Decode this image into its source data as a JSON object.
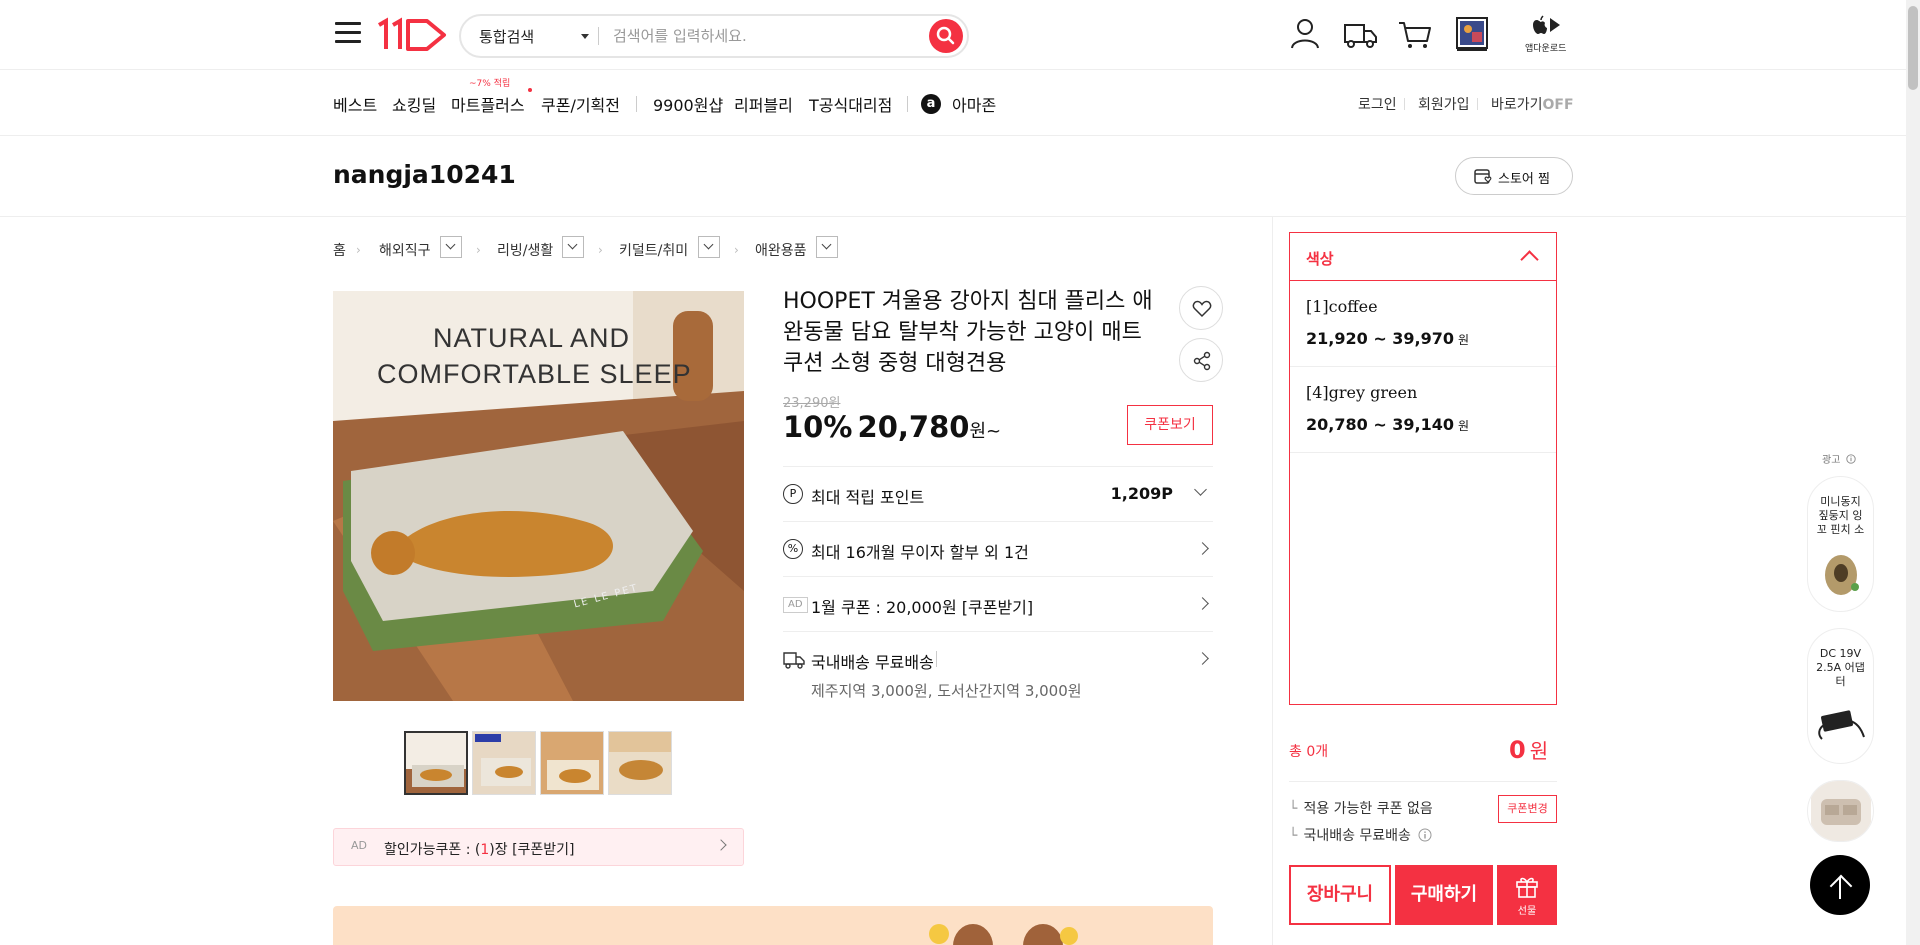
{
  "header": {
    "search_category": "통합검색",
    "search_placeholder": "검색어를 입력하세요.",
    "app_download": "앱다운로드"
  },
  "gnb": {
    "items": [
      "베스트",
      "쇼킹딜",
      "마트플러스",
      "쿠폰/기획전",
      "9900원샵",
      "리퍼블리",
      "T공식대리점",
      "아마존"
    ],
    "mart_badge": "~7% 적립",
    "login": "로그인",
    "signup": "회원가입",
    "shortcut": "바로가기",
    "shortcut_state": "OFF"
  },
  "store": {
    "name": "nangja10241",
    "follow": "스토어 찜"
  },
  "breadcrumb": [
    "홈",
    "해외직구",
    "리빙/생활",
    "키덜트/취미",
    "애완용품"
  ],
  "product": {
    "image_text_line1": "NATURAL AND",
    "image_text_line2": "COMFORTABLE SLEEP",
    "image_brand": "LE LE PET",
    "title": "HOOPET 겨울용 강아지 침대 플리스 애완동물 담요 탈부착 가능한 고양이 매트 쿠션 소형 중형 대형견용",
    "original_price": "23,290원",
    "discount": "10%",
    "price": "20,780",
    "price_unit": "원~",
    "coupon_view": "쿠폰보기",
    "points_label": "최대 적립 포인트",
    "points_value": "1,209P",
    "installment": "최대 16개월 무이자 할부 외 1건",
    "ad_tag": "AD",
    "coupon_jan": "1월 쿠폰 : 20,000원 [쿠폰받기]",
    "shipping": "국내배송 무료배송",
    "shipping_extra": "제주지역 3,000원, 도서산간지역 3,000원",
    "discount_coupon_pre": "할인가능쿠폰 : (",
    "discount_coupon_count": "1",
    "discount_coupon_post": ")장 [쿠폰받기]"
  },
  "options": {
    "header": "색상",
    "items": [
      {
        "name": "[1]coffee",
        "price": "21,920 ~ 39,970",
        "unit": "원"
      },
      {
        "name": "[4]grey green",
        "price": "20,780 ~ 39,140",
        "unit": "원"
      }
    ]
  },
  "summary": {
    "total_label": "총 0개",
    "total_value": "0",
    "total_unit": "원",
    "no_coupon": "적용 가능한 쿠폰 없음",
    "coupon_change": "쿠폰변경",
    "free_shipping": "국내배송 무료배송"
  },
  "actions": {
    "cart": "장바구니",
    "buy": "구매하기",
    "gift": "선물"
  },
  "side": {
    "ad_label": "광고",
    "card1": "미니동지 짚둥지 잉꼬 핀치 소",
    "card2": "DC 19V 2.5A 어댑터"
  },
  "colors": {
    "brand": "#f43142",
    "coupon_bg": "#fff0f2"
  }
}
